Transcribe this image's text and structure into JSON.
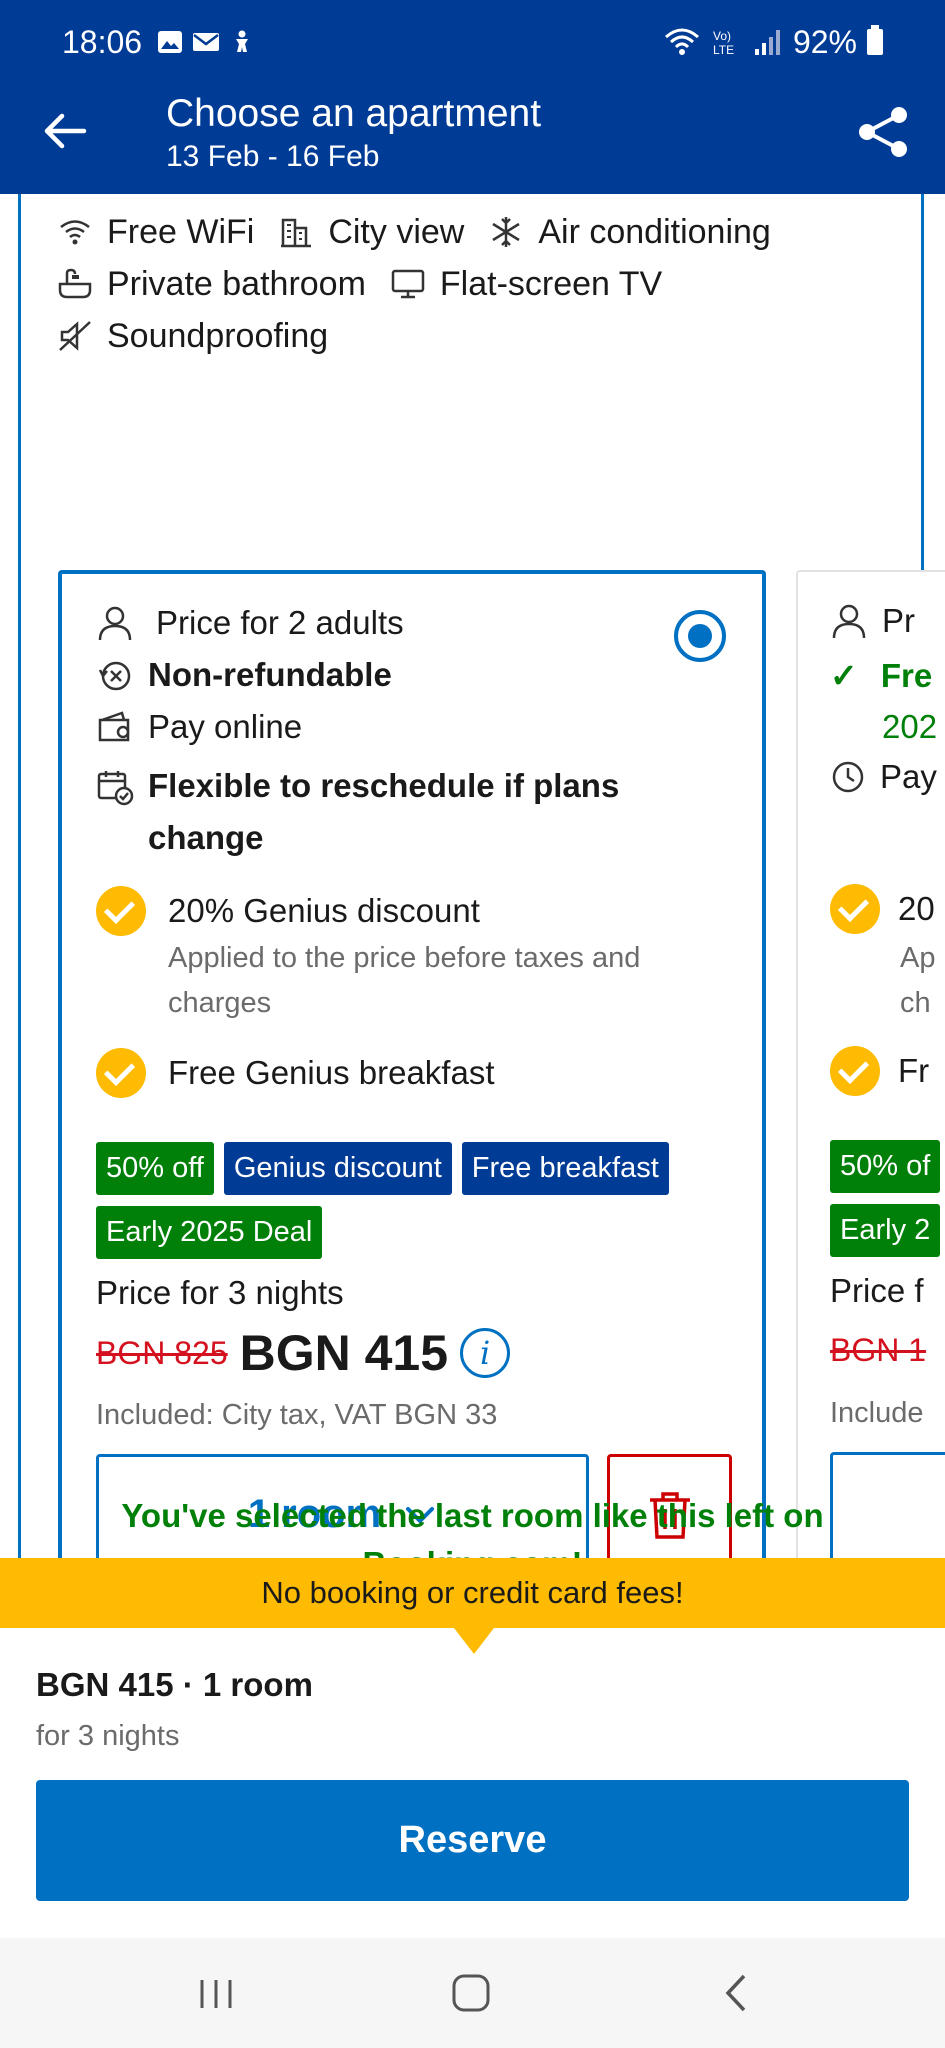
{
  "status": {
    "time": "18:06",
    "battery": "92%"
  },
  "header": {
    "title": "Choose an apartment",
    "dates": "13 Feb - 16 Feb"
  },
  "facilities": [
    {
      "icon": "wifi-icon",
      "label": "Free WiFi"
    },
    {
      "icon": "city-icon",
      "label": "City view"
    },
    {
      "icon": "snowflake-icon",
      "label": "Air conditioning"
    },
    {
      "icon": "bathtub-icon",
      "label": "Private bathroom"
    },
    {
      "icon": "tv-icon",
      "label": "Flat-screen TV"
    },
    {
      "icon": "soundproof-icon",
      "label": "Soundproofing"
    }
  ],
  "option": {
    "occupancy": "Price for 2 adults",
    "refund": "Non-refundable",
    "payment": "Pay online",
    "reschedule": "Flexible to reschedule if plans change",
    "perk1_title": "20% Genius discount",
    "perk1_sub": "Applied to the price before taxes and charges",
    "perk2_title": "Free Genius breakfast",
    "badges": [
      "50% off",
      "Genius discount",
      "Free breakfast",
      "Early 2025 Deal"
    ],
    "price_label": "Price for 3 nights",
    "old_price": "BGN 825",
    "new_price": "BGN 415",
    "included": "Included: City tax, VAT BGN 33",
    "room_select": "1 room"
  },
  "peek": {
    "occupancy": "Pr",
    "refund": "Fre",
    "refund2": "202",
    "payment": "Pay",
    "perk1": "20",
    "perk1_sub": "Ap",
    "perk1_sub2": "ch",
    "perk2": "Fr",
    "badge1": "50% of",
    "badge2": "Early 2",
    "price_label": "Price f",
    "old_price": "BGN 1",
    "included": "Include"
  },
  "last_room": "You've selected the last room like this left on Booking.com!",
  "fee_banner": "No booking or credit card fees!",
  "summary": {
    "price": "BGN 415 · 1 room",
    "nights": "for 3 nights",
    "reserve": "Reserve"
  },
  "colors": {
    "brand": "#003b95",
    "primary": "#0071c2",
    "genius_yellow": "#febb02",
    "green": "#008009",
    "red": "#d4111e"
  }
}
